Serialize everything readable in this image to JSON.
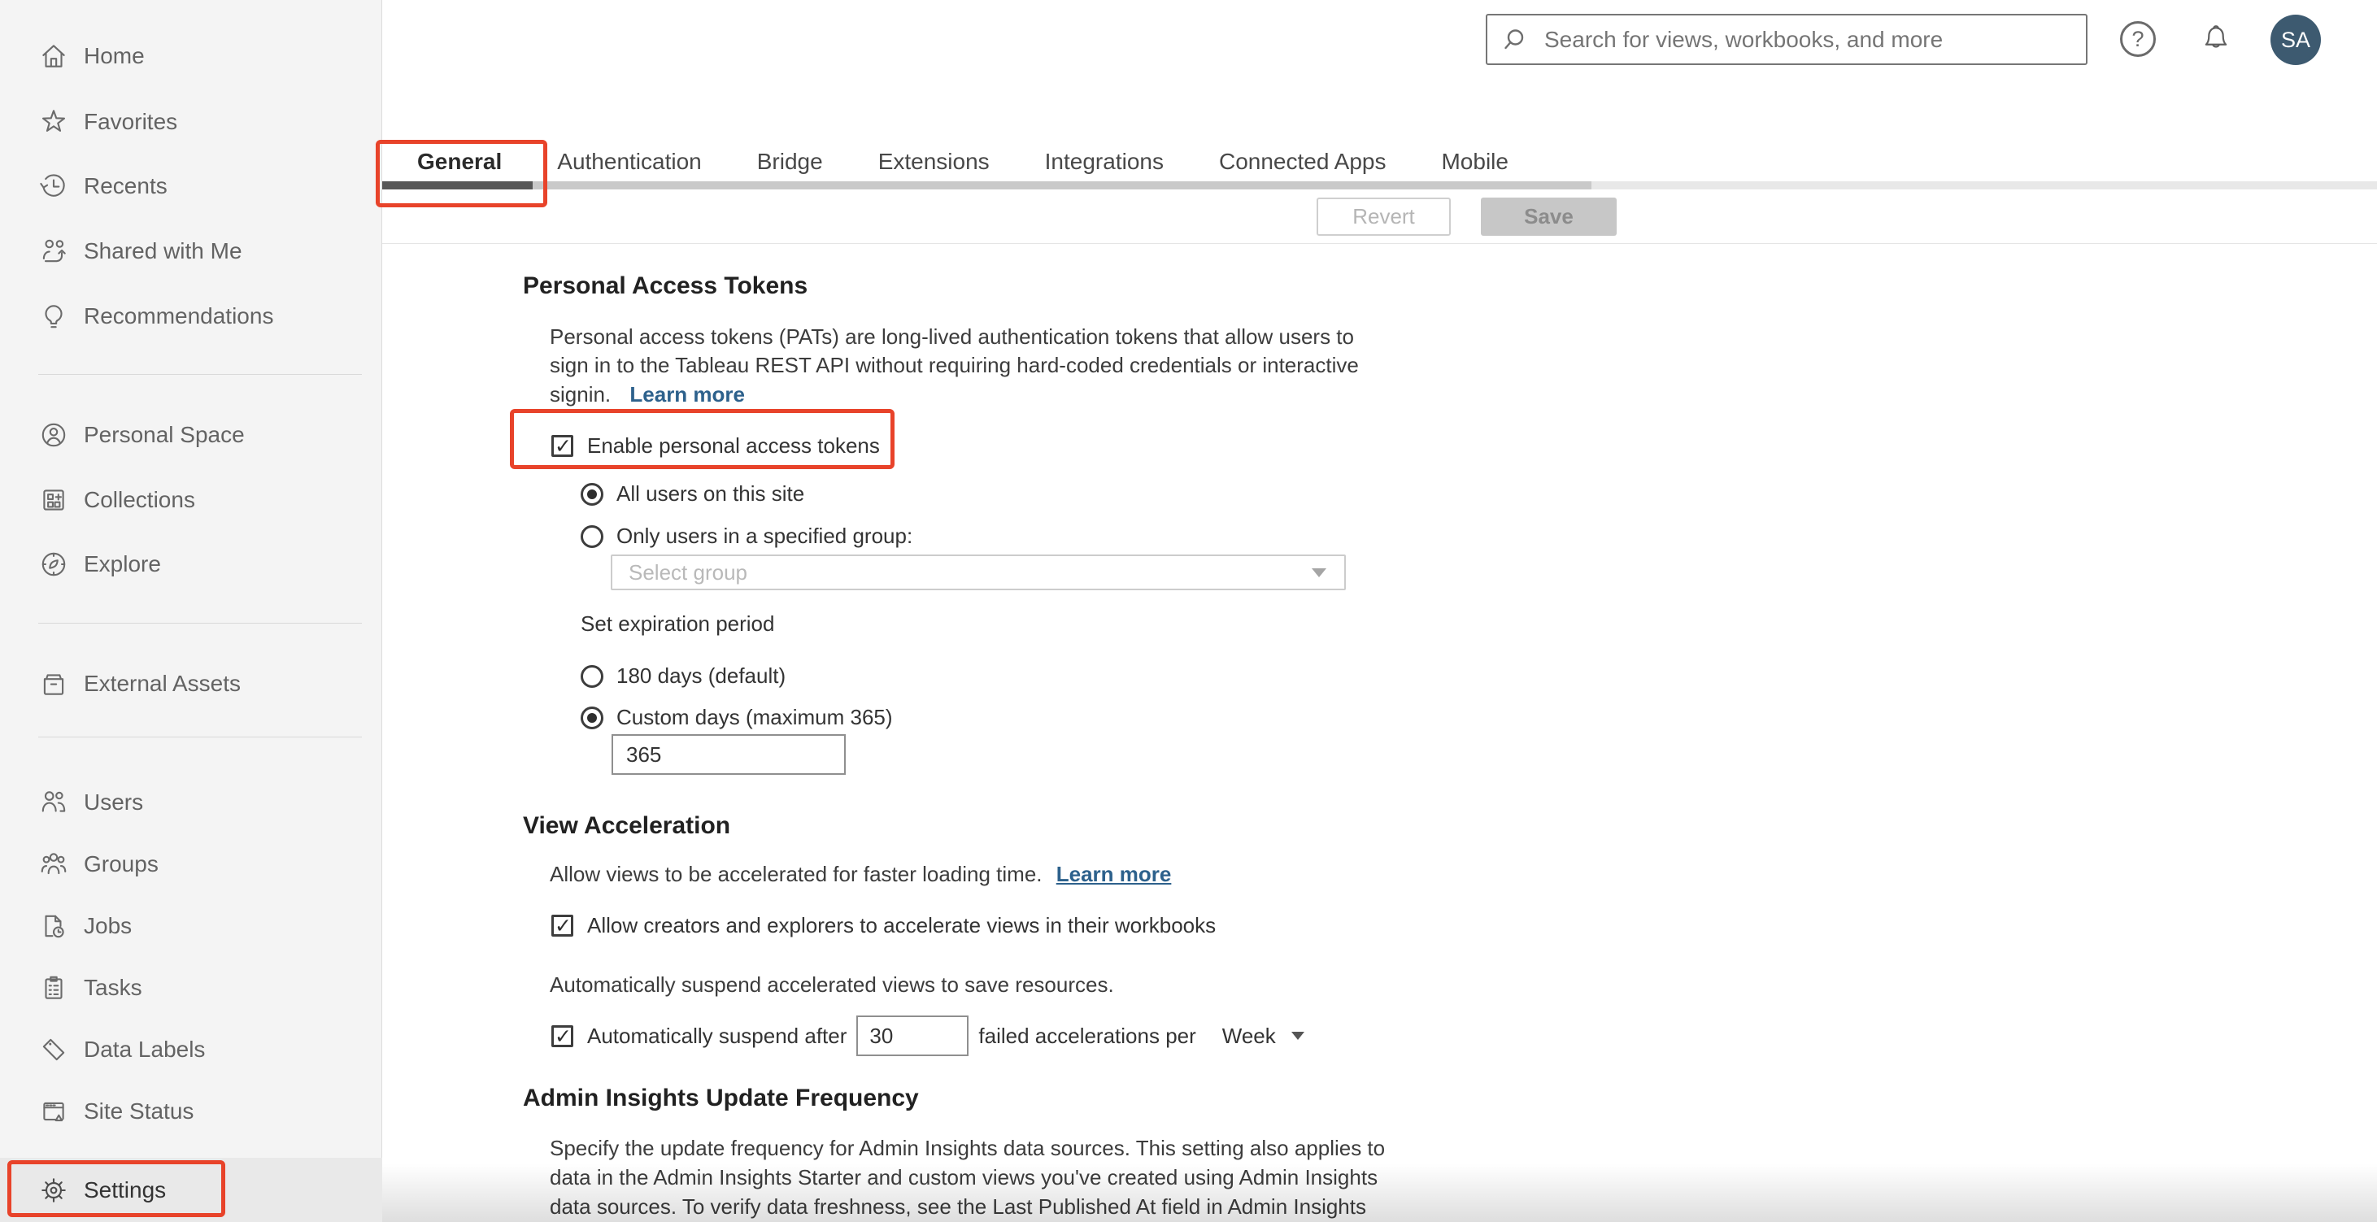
{
  "header": {
    "search_placeholder": "Search for views, workbooks, and more",
    "avatar_initials": "SA"
  },
  "sidebar": {
    "items": [
      {
        "label": "Home",
        "icon": "home-icon"
      },
      {
        "label": "Favorites",
        "icon": "star-icon"
      },
      {
        "label": "Recents",
        "icon": "history-icon"
      },
      {
        "label": "Shared with Me",
        "icon": "shared-icon"
      },
      {
        "label": "Recommendations",
        "icon": "lightbulb-icon"
      },
      {
        "label": "Personal Space",
        "icon": "person-circle-icon"
      },
      {
        "label": "Collections",
        "icon": "collections-icon"
      },
      {
        "label": "Explore",
        "icon": "compass-icon"
      },
      {
        "label": "External Assets",
        "icon": "box-icon"
      },
      {
        "label": "Users",
        "icon": "users-icon"
      },
      {
        "label": "Groups",
        "icon": "groups-icon"
      },
      {
        "label": "Jobs",
        "icon": "file-clock-icon"
      },
      {
        "label": "Tasks",
        "icon": "clipboard-icon"
      },
      {
        "label": "Data Labels",
        "icon": "tag-icon"
      },
      {
        "label": "Site Status",
        "icon": "browser-alert-icon"
      },
      {
        "label": "Settings",
        "icon": "gear-icon",
        "selected": true
      }
    ]
  },
  "tabs": [
    {
      "label": "General",
      "active": true
    },
    {
      "label": "Authentication"
    },
    {
      "label": "Bridge"
    },
    {
      "label": "Extensions"
    },
    {
      "label": "Integrations"
    },
    {
      "label": "Connected Apps"
    },
    {
      "label": "Mobile"
    }
  ],
  "toolbar": {
    "revert_label": "Revert",
    "save_label": "Save"
  },
  "sections": {
    "pat": {
      "title": "Personal Access Tokens",
      "desc_line1": "Personal access tokens (PATs) are long-lived authentication tokens that allow users to",
      "desc_line2": "sign in to the Tableau REST API without requiring hard-coded credentials or interactive",
      "desc_line3": "signin.",
      "learn_more": "Learn more",
      "enable_label": "Enable personal access tokens",
      "radio_all_users": "All users on this site",
      "radio_group": "Only users in a specified group:",
      "group_placeholder": "Select group",
      "expiration_label": "Set expiration period",
      "radio_180": "180 days (default)",
      "radio_custom": "Custom days (maximum 365)",
      "custom_days_value": "365"
    },
    "view_accel": {
      "title": "View Acceleration",
      "desc": "Allow views to be accelerated for faster loading time.",
      "learn_more": "Learn more",
      "allow_label": "Allow creators and explorers to accelerate views in their workbooks",
      "suspend_desc": "Automatically suspend accelerated views to save resources.",
      "suspend_prefix": "Automatically suspend after",
      "suspend_value": "30",
      "suspend_suffix": "failed accelerations per",
      "period_value": "Week"
    },
    "admin_insights": {
      "title": "Admin Insights Update Frequency",
      "desc_line1": "Specify the update frequency for Admin Insights data sources. This setting also applies to",
      "desc_line2": "data in the Admin Insights Starter and custom views you've created using Admin Insights",
      "desc_line3": "data sources. To verify data freshness, see the Last Published At field in Admin Insights"
    }
  },
  "colors": {
    "annotation_red": "#e8432a",
    "link_blue": "#2d618c",
    "avatar_bg": "#3d5a70",
    "active_tab_underline": "#575757"
  }
}
